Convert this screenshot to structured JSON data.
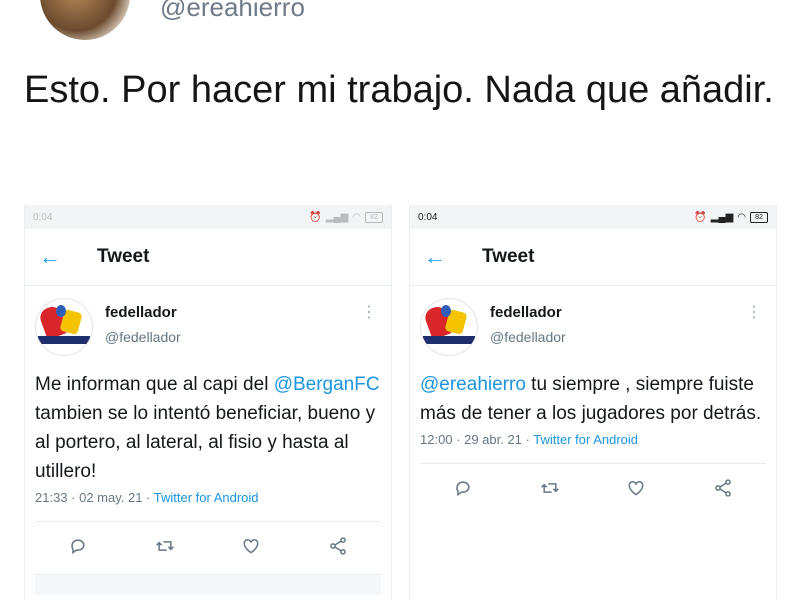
{
  "header": {
    "handle": "@ereahierro",
    "text": "Esto. Por hacer mi trabajo. Nada que añadir."
  },
  "screenshots": [
    {
      "status_time": "0:04",
      "title": "Tweet",
      "author": {
        "name": "fedellador",
        "handle": "@fedellador"
      },
      "text_before": "Me informan que al capi del ",
      "mention": "@BerganFC",
      "text_after": " tambien se lo intentó beneficiar, bueno y al portero, al lateral, al fisio y hasta al utillero!",
      "timestamp": "21:33 · 02 may. 21 · ",
      "source": "Twitter for Android"
    },
    {
      "status_time": "0:04",
      "title": "Tweet",
      "author": {
        "name": "fedellador",
        "handle": "@fedellador"
      },
      "text_before": "",
      "mention": "@ereahierro",
      "text_after": " tu siempre , siempre fuiste más de tener a los jugadores por detrás.",
      "timestamp": "12:00 · 29 abr. 21 · ",
      "source": "Twitter for Android"
    }
  ],
  "icons": {
    "back": "arrow-left-icon",
    "reply": "reply-icon",
    "retweet": "retweet-icon",
    "like": "heart-icon",
    "share": "share-icon",
    "more": "kebab-menu-icon"
  },
  "colors": {
    "accent": "#1da1f2",
    "mention": "#1b95e0",
    "secondary_text": "#657786"
  }
}
